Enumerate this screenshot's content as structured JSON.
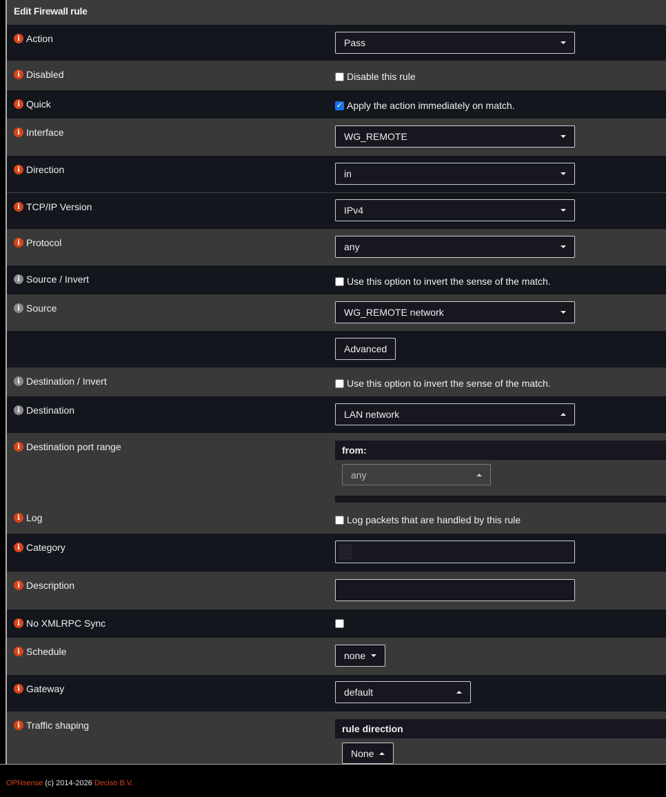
{
  "panel": {
    "title": "Edit Firewall rule"
  },
  "rows": {
    "action": {
      "label": "Action",
      "value": "Pass"
    },
    "disabled": {
      "label": "Disabled",
      "checkbox_label": "Disable this rule",
      "checked": false
    },
    "quick": {
      "label": "Quick",
      "checkbox_label": "Apply the action immediately on match.",
      "checked": true
    },
    "interface": {
      "label": "Interface",
      "value": "WG_REMOTE"
    },
    "direction": {
      "label": "Direction",
      "value": "in"
    },
    "tcpip": {
      "label": "TCP/IP Version",
      "value": "IPv4"
    },
    "protocol": {
      "label": "Protocol",
      "value": "any"
    },
    "source_invert": {
      "label": "Source / Invert",
      "checkbox_label": "Use this option to invert the sense of the match.",
      "checked": false
    },
    "source": {
      "label": "Source",
      "value": "WG_REMOTE network"
    },
    "advanced": {
      "button_label": "Advanced"
    },
    "dest_invert": {
      "label": "Destination / Invert",
      "checkbox_label": "Use this option to invert the sense of the match.",
      "checked": false
    },
    "destination": {
      "label": "Destination",
      "value": "LAN network"
    },
    "dest_port": {
      "label": "Destination port range",
      "from_label": "from:",
      "from_value": "any"
    },
    "log": {
      "label": "Log",
      "checkbox_label": "Log packets that are handled by this rule",
      "checked": false
    },
    "category": {
      "label": "Category",
      "value": ""
    },
    "description": {
      "label": "Description",
      "value": ""
    },
    "xmlrpc": {
      "label": "No XMLRPC Sync",
      "checked": false
    },
    "schedule": {
      "label": "Schedule",
      "value": "none"
    },
    "gateway": {
      "label": "Gateway",
      "value": "default"
    },
    "traffic": {
      "label": "Traffic shaping",
      "sub_label": "rule direction",
      "value": "None"
    }
  },
  "footer": {
    "brand": "OPNsense",
    "copyright": "(c) 2014-2026",
    "company": "Deciso B.V."
  },
  "colors": {
    "accent": "#d9441a",
    "bg_dark": "#14161d",
    "bg_light": "#393939"
  }
}
